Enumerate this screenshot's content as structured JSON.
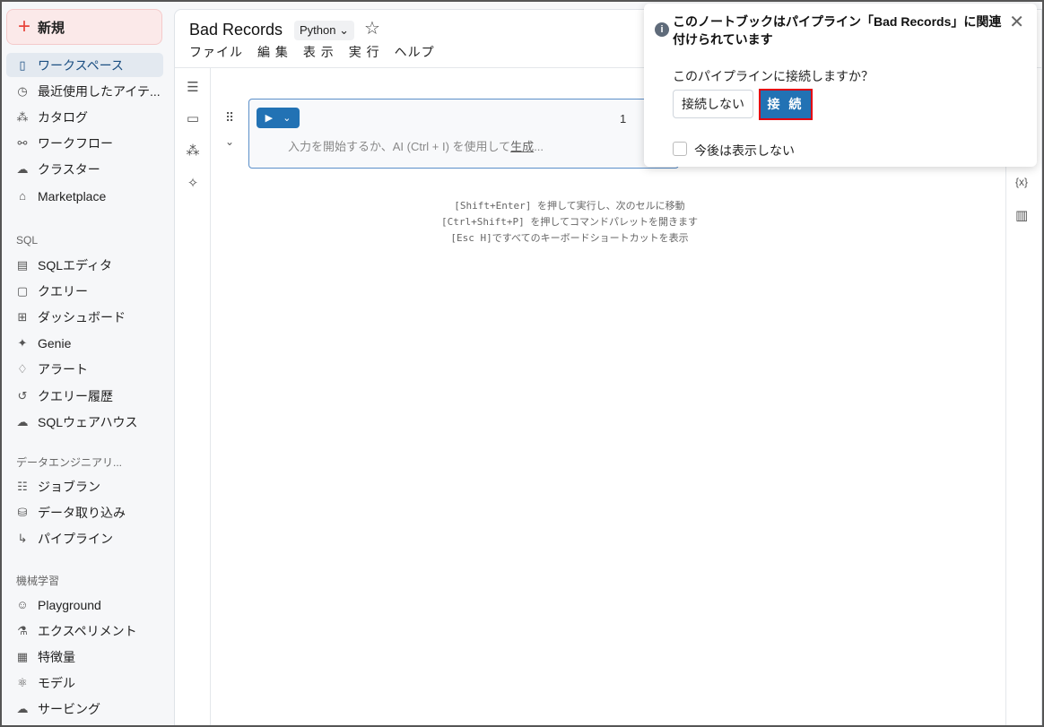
{
  "sidebar": {
    "new_label": "新規",
    "items_top": [
      {
        "label": "ワークスペース",
        "icon": "notebook-icon",
        "active": true
      },
      {
        "label": "最近使用したアイテ...",
        "icon": "clock-icon"
      },
      {
        "label": "カタログ",
        "icon": "catalog-icon"
      },
      {
        "label": "ワークフロー",
        "icon": "workflow-icon"
      },
      {
        "label": "クラスター",
        "icon": "cloud-icon"
      },
      {
        "label": "Marketplace",
        "icon": "store-icon"
      }
    ],
    "sql_header": "SQL",
    "items_sql": [
      {
        "label": "SQLエディタ",
        "icon": "sql-editor-icon"
      },
      {
        "label": "クエリー",
        "icon": "query-icon"
      },
      {
        "label": "ダッシュボード",
        "icon": "dashboard-icon"
      },
      {
        "label": "Genie",
        "icon": "genie-icon"
      },
      {
        "label": "アラート",
        "icon": "bell-icon"
      },
      {
        "label": "クエリー履歴",
        "icon": "history-icon"
      },
      {
        "label": "SQLウェアハウス",
        "icon": "warehouse-icon"
      }
    ],
    "de_header": "データエンジニアリ...",
    "items_de": [
      {
        "label": "ジョブラン",
        "icon": "job-runs-icon"
      },
      {
        "label": "データ取り込み",
        "icon": "ingest-icon"
      },
      {
        "label": "パイプライン",
        "icon": "pipeline-icon"
      }
    ],
    "ml_header": "機械学習",
    "items_ml": [
      {
        "label": "Playground",
        "icon": "playground-icon"
      },
      {
        "label": "エクスペリメント",
        "icon": "experiment-icon"
      },
      {
        "label": "特徴量",
        "icon": "feature-icon"
      },
      {
        "label": "モデル",
        "icon": "model-icon"
      },
      {
        "label": "サービング",
        "icon": "serving-icon"
      }
    ]
  },
  "notebook": {
    "title": "Bad Records",
    "language": "Python",
    "menu": [
      "ファイル",
      "編 集",
      "表 示",
      "実 行",
      "ヘルプ"
    ],
    "cell_number": "1",
    "placeholder_prefix": "入力を開始するか、AI (Ctrl + I) を使用して",
    "placeholder_link": "生成",
    "placeholder_suffix": "...",
    "hints": [
      "[Shift+Enter] を押して実行し、次のセルに移動",
      "[Ctrl+Shift+P] を押してコマンドパレットを開きます",
      "[Esc H]ですべてのキーボードショートカットを表示"
    ]
  },
  "popup": {
    "title": "このノートブックはパイプライン「Bad Records」に関連付けられています",
    "question": "このパイプラインに接続しますか？",
    "cancel": "接続しない",
    "connect": "接 続",
    "dont_show": "今後は表示しない"
  },
  "colors": {
    "accent": "#2272b4",
    "highlight": "#e3000f"
  }
}
